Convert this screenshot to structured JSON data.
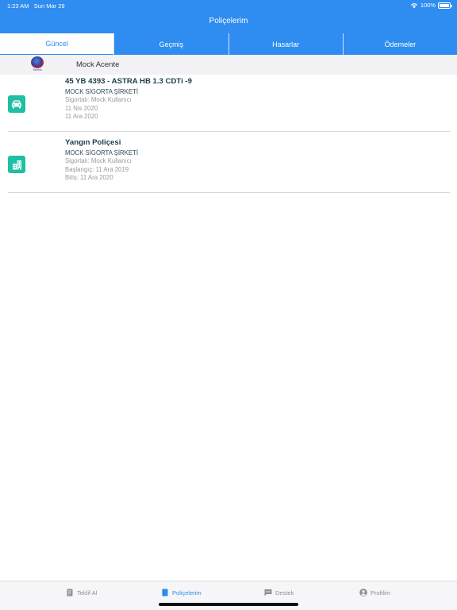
{
  "status_bar": {
    "time": "1:23 AM",
    "date": "Sun Mar 29",
    "battery": "100%",
    "battery_level": 1.0
  },
  "nav": {
    "title": "Poliçelerim"
  },
  "tabs": [
    {
      "label": "Güncel",
      "active": true
    },
    {
      "label": "Geçmiş",
      "active": false
    },
    {
      "label": "Hasarlar",
      "active": false
    },
    {
      "label": "Ödemeler",
      "active": false
    }
  ],
  "agency": {
    "logo_text": "Yazılım",
    "name": "Mock Acente"
  },
  "policies": [
    {
      "icon": "car-icon",
      "title": "45 YB 4393 - ASTRA HB 1.3 CDTi -9",
      "company": "MOCK SİGORTA ŞİRKETİ",
      "insured": "Sigortalı: Mock Kullanıcı",
      "start": "11 Nis 2020",
      "end": "11 Ara 2020"
    },
    {
      "icon": "building-icon",
      "title": "Yangın Poliçesi",
      "company": "MOCK SİGORTA ŞİRKETİ",
      "insured": "Sigortalı: Mock Kullanıcı",
      "start": "Başlangıç: 11 Ara 2019",
      "end": "Bitiş: 11 Ara 2020"
    }
  ],
  "tabbar": [
    {
      "label": "Teklif Al",
      "icon": "document-icon",
      "active": false
    },
    {
      "label": "Poliçelerim",
      "icon": "book-icon",
      "active": true
    },
    {
      "label": "Destek",
      "icon": "chat-icon",
      "active": false
    },
    {
      "label": "Profilim",
      "icon": "user-icon",
      "active": false
    }
  ],
  "colors": {
    "primary": "#2f8cf0",
    "teal": "#1ebfa3",
    "title_text": "#1c3c4c",
    "muted_text": "#9a9a9a"
  }
}
